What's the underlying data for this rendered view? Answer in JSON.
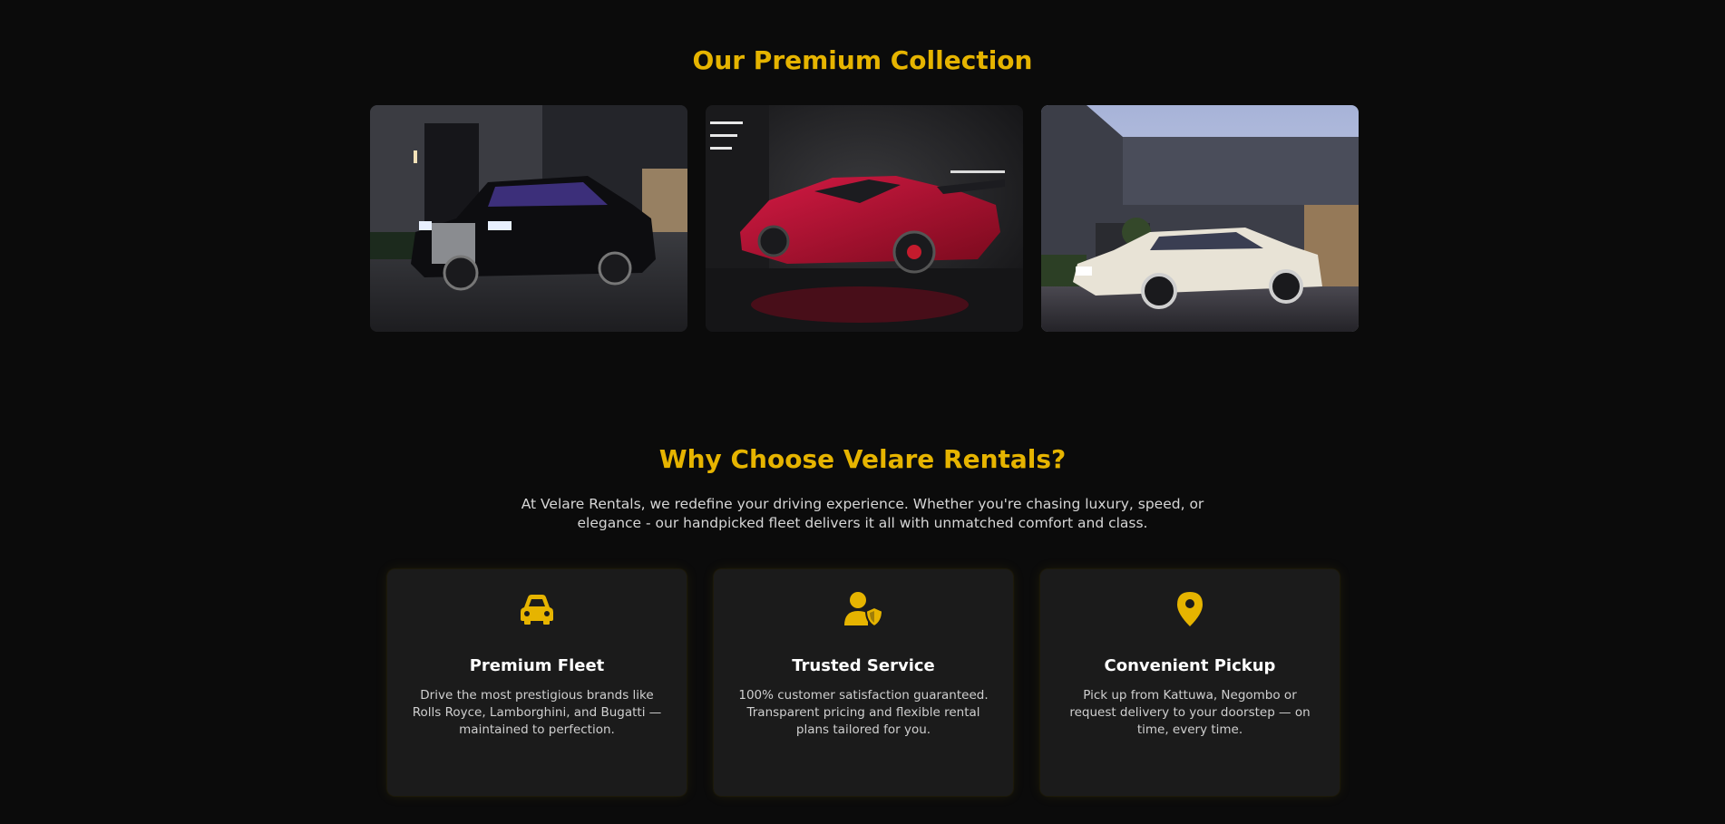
{
  "collection": {
    "title": "Our Premium Collection",
    "cars": [
      {
        "name": "black-luxury-sedan",
        "body_color": "#0d0d10",
        "icon": "car-photo"
      },
      {
        "name": "red-supercar",
        "body_color": "#b0102e",
        "icon": "car-photo"
      },
      {
        "name": "white-luxury-sedan",
        "body_color": "#e8e3d6",
        "icon": "car-photo"
      }
    ]
  },
  "why": {
    "title": "Why Choose Velare Rentals?",
    "intro": "At Velare Rentals, we redefine your driving experience. Whether you're chasing luxury, speed, or elegance - our handpicked fleet delivers it all with unmatched comfort and class.",
    "features": [
      {
        "icon": "car-icon",
        "title": "Premium Fleet",
        "text": "Drive the most prestigious brands like Rolls Royce, Lamborghini, and Bugatti — maintained to perfection."
      },
      {
        "icon": "user-shield-icon",
        "title": "Trusted Service",
        "text": "100% customer satisfaction guaranteed. Transparent pricing and flexible rental plans tailored for you."
      },
      {
        "icon": "location-pin-icon",
        "title": "Convenient Pickup",
        "text": "Pick up from Kattuwa, Negombo or request delivery to your doorstep — on time, every time."
      }
    ]
  },
  "colors": {
    "accent": "#e6b400",
    "background": "#0b0b0b",
    "card": "#1b1b1b"
  }
}
